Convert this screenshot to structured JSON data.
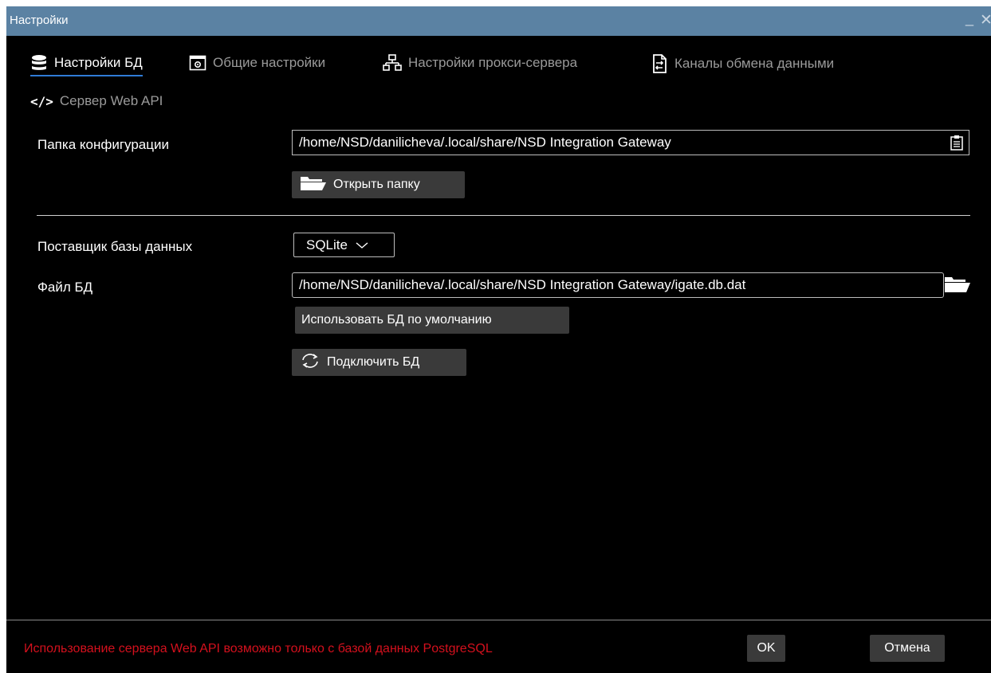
{
  "window": {
    "title": "Настройки",
    "minimize_glyph": "_",
    "close_glyph": "✕"
  },
  "tabs": [
    {
      "label": "Настройки БД",
      "icon": "database-icon",
      "active": true
    },
    {
      "label": "Общие настройки",
      "icon": "settings-window-icon",
      "active": false
    },
    {
      "label": "Настройки прокси-сервера",
      "icon": "network-icon",
      "active": false
    },
    {
      "label": "Каналы обмена данными",
      "icon": "exchange-document-icon",
      "active": false
    },
    {
      "label": "Сервер Web API",
      "icon": "code-icon",
      "active": false
    }
  ],
  "config_folder": {
    "label": "Папка конфигурации",
    "value": "/home/NSD/danilicheva/.local/share/NSD Integration Gateway",
    "open_button": "Открыть папку"
  },
  "db_provider": {
    "label": "Поставщик базы данных",
    "selected": "SQLite"
  },
  "db_file": {
    "label": "Файл БД",
    "value": "/home/NSD/danilicheva/.local/share/NSD Integration Gateway/igate.db.dat",
    "default_button": "Использовать БД по умолчанию",
    "connect_button": "Подключить БД"
  },
  "footer": {
    "error": "Использование сервера Web API возможно только с базой данных PostgreSQL",
    "ok": "OK",
    "cancel": "Отмена"
  },
  "colors": {
    "titlebar": "#5b82a3",
    "accent": "#2f7bd6",
    "error": "#d4101d",
    "button": "#3a3a3a"
  }
}
